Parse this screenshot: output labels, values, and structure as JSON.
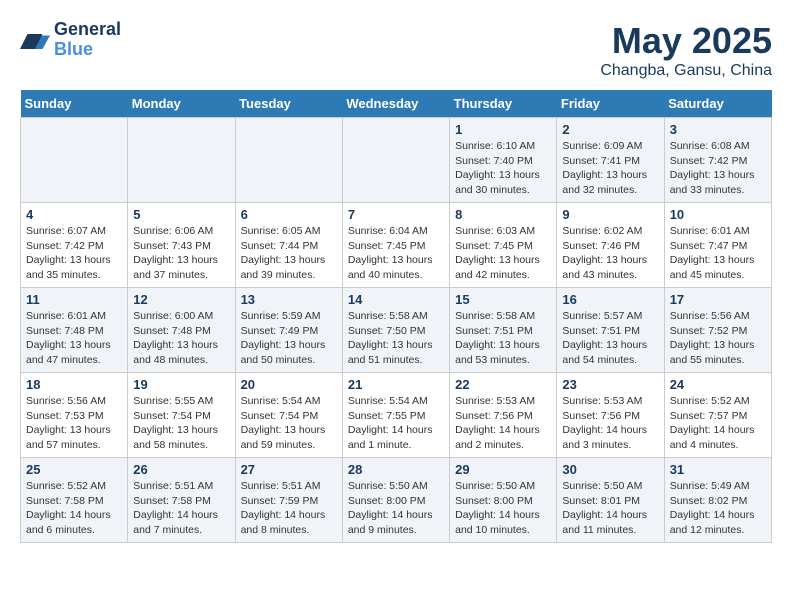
{
  "header": {
    "logo_line1": "General",
    "logo_line2": "Blue",
    "month_title": "May 2025",
    "location": "Changba, Gansu, China"
  },
  "weekdays": [
    "Sunday",
    "Monday",
    "Tuesday",
    "Wednesday",
    "Thursday",
    "Friday",
    "Saturday"
  ],
  "weeks": [
    [
      {
        "num": "",
        "info": ""
      },
      {
        "num": "",
        "info": ""
      },
      {
        "num": "",
        "info": ""
      },
      {
        "num": "",
        "info": ""
      },
      {
        "num": "1",
        "info": "Sunrise: 6:10 AM\nSunset: 7:40 PM\nDaylight: 13 hours\nand 30 minutes."
      },
      {
        "num": "2",
        "info": "Sunrise: 6:09 AM\nSunset: 7:41 PM\nDaylight: 13 hours\nand 32 minutes."
      },
      {
        "num": "3",
        "info": "Sunrise: 6:08 AM\nSunset: 7:42 PM\nDaylight: 13 hours\nand 33 minutes."
      }
    ],
    [
      {
        "num": "4",
        "info": "Sunrise: 6:07 AM\nSunset: 7:42 PM\nDaylight: 13 hours\nand 35 minutes."
      },
      {
        "num": "5",
        "info": "Sunrise: 6:06 AM\nSunset: 7:43 PM\nDaylight: 13 hours\nand 37 minutes."
      },
      {
        "num": "6",
        "info": "Sunrise: 6:05 AM\nSunset: 7:44 PM\nDaylight: 13 hours\nand 39 minutes."
      },
      {
        "num": "7",
        "info": "Sunrise: 6:04 AM\nSunset: 7:45 PM\nDaylight: 13 hours\nand 40 minutes."
      },
      {
        "num": "8",
        "info": "Sunrise: 6:03 AM\nSunset: 7:45 PM\nDaylight: 13 hours\nand 42 minutes."
      },
      {
        "num": "9",
        "info": "Sunrise: 6:02 AM\nSunset: 7:46 PM\nDaylight: 13 hours\nand 43 minutes."
      },
      {
        "num": "10",
        "info": "Sunrise: 6:01 AM\nSunset: 7:47 PM\nDaylight: 13 hours\nand 45 minutes."
      }
    ],
    [
      {
        "num": "11",
        "info": "Sunrise: 6:01 AM\nSunset: 7:48 PM\nDaylight: 13 hours\nand 47 minutes."
      },
      {
        "num": "12",
        "info": "Sunrise: 6:00 AM\nSunset: 7:48 PM\nDaylight: 13 hours\nand 48 minutes."
      },
      {
        "num": "13",
        "info": "Sunrise: 5:59 AM\nSunset: 7:49 PM\nDaylight: 13 hours\nand 50 minutes."
      },
      {
        "num": "14",
        "info": "Sunrise: 5:58 AM\nSunset: 7:50 PM\nDaylight: 13 hours\nand 51 minutes."
      },
      {
        "num": "15",
        "info": "Sunrise: 5:58 AM\nSunset: 7:51 PM\nDaylight: 13 hours\nand 53 minutes."
      },
      {
        "num": "16",
        "info": "Sunrise: 5:57 AM\nSunset: 7:51 PM\nDaylight: 13 hours\nand 54 minutes."
      },
      {
        "num": "17",
        "info": "Sunrise: 5:56 AM\nSunset: 7:52 PM\nDaylight: 13 hours\nand 55 minutes."
      }
    ],
    [
      {
        "num": "18",
        "info": "Sunrise: 5:56 AM\nSunset: 7:53 PM\nDaylight: 13 hours\nand 57 minutes."
      },
      {
        "num": "19",
        "info": "Sunrise: 5:55 AM\nSunset: 7:54 PM\nDaylight: 13 hours\nand 58 minutes."
      },
      {
        "num": "20",
        "info": "Sunrise: 5:54 AM\nSunset: 7:54 PM\nDaylight: 13 hours\nand 59 minutes."
      },
      {
        "num": "21",
        "info": "Sunrise: 5:54 AM\nSunset: 7:55 PM\nDaylight: 14 hours\nand 1 minute."
      },
      {
        "num": "22",
        "info": "Sunrise: 5:53 AM\nSunset: 7:56 PM\nDaylight: 14 hours\nand 2 minutes."
      },
      {
        "num": "23",
        "info": "Sunrise: 5:53 AM\nSunset: 7:56 PM\nDaylight: 14 hours\nand 3 minutes."
      },
      {
        "num": "24",
        "info": "Sunrise: 5:52 AM\nSunset: 7:57 PM\nDaylight: 14 hours\nand 4 minutes."
      }
    ],
    [
      {
        "num": "25",
        "info": "Sunrise: 5:52 AM\nSunset: 7:58 PM\nDaylight: 14 hours\nand 6 minutes."
      },
      {
        "num": "26",
        "info": "Sunrise: 5:51 AM\nSunset: 7:58 PM\nDaylight: 14 hours\nand 7 minutes."
      },
      {
        "num": "27",
        "info": "Sunrise: 5:51 AM\nSunset: 7:59 PM\nDaylight: 14 hours\nand 8 minutes."
      },
      {
        "num": "28",
        "info": "Sunrise: 5:50 AM\nSunset: 8:00 PM\nDaylight: 14 hours\nand 9 minutes."
      },
      {
        "num": "29",
        "info": "Sunrise: 5:50 AM\nSunset: 8:00 PM\nDaylight: 14 hours\nand 10 minutes."
      },
      {
        "num": "30",
        "info": "Sunrise: 5:50 AM\nSunset: 8:01 PM\nDaylight: 14 hours\nand 11 minutes."
      },
      {
        "num": "31",
        "info": "Sunrise: 5:49 AM\nSunset: 8:02 PM\nDaylight: 14 hours\nand 12 minutes."
      }
    ]
  ]
}
